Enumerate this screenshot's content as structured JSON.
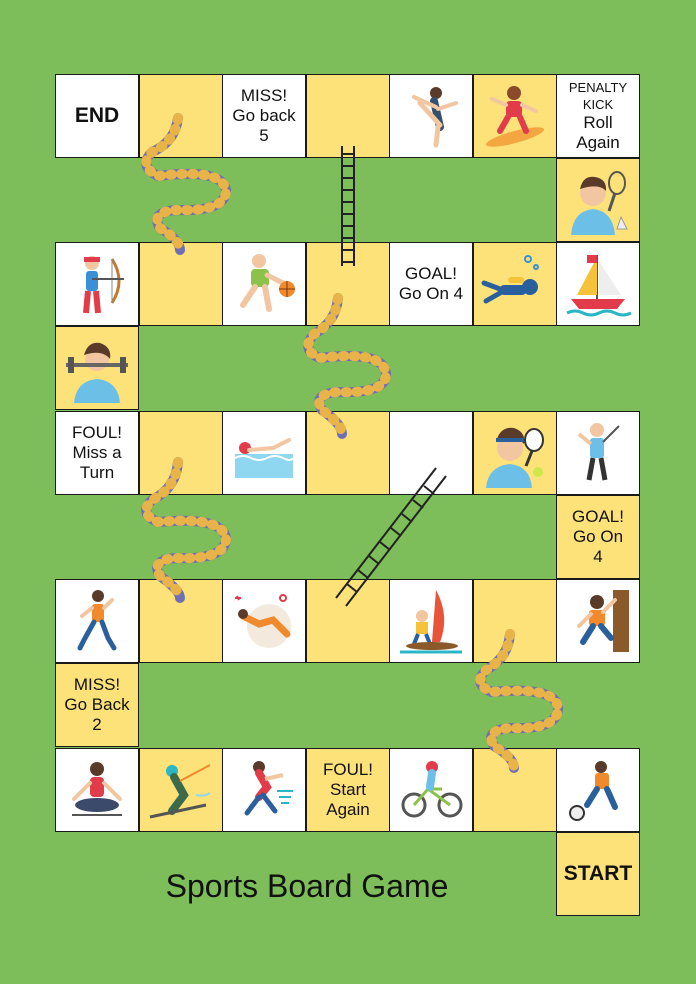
{
  "title": "Sports Board Game",
  "colors": {
    "background": "#7dbd5a",
    "tile_yellow": "#fde27a",
    "tile_white": "#ffffff",
    "snake": "#6f6fb3",
    "snake_band": "#e8b44a",
    "ladder": "#222222"
  },
  "cells": {
    "end": "END",
    "miss5": "MISS!\nGo back\n5",
    "penalty_small": "PENALTY\nKICK",
    "penalty": "Roll\nAgain",
    "goal4a": "GOAL!\nGo On 4",
    "foul_miss": "FOUL!\nMiss a\nTurn",
    "goal4b": "GOAL!\nGo On\n4",
    "miss2": "MISS!\nGo Back\n2",
    "foul_start": "FOUL!\nStart\nAgain",
    "start": "START"
  },
  "icons": [
    "gymnast-icon",
    "surfer-icon",
    "badminton-player-icon",
    "archer-icon",
    "basketball-player-icon",
    "scuba-diver-icon",
    "sailboat-icon",
    "weightlifter-icon",
    "swimmer-icon",
    "tennis-player-icon",
    "golfer-icon",
    "runner-icon",
    "diver-icon",
    "windsurfer-icon",
    "climber-icon",
    "yoga-icon",
    "skier-icon",
    "hockey-skater-icon",
    "cyclist-icon",
    "soccer-player-icon"
  ]
}
